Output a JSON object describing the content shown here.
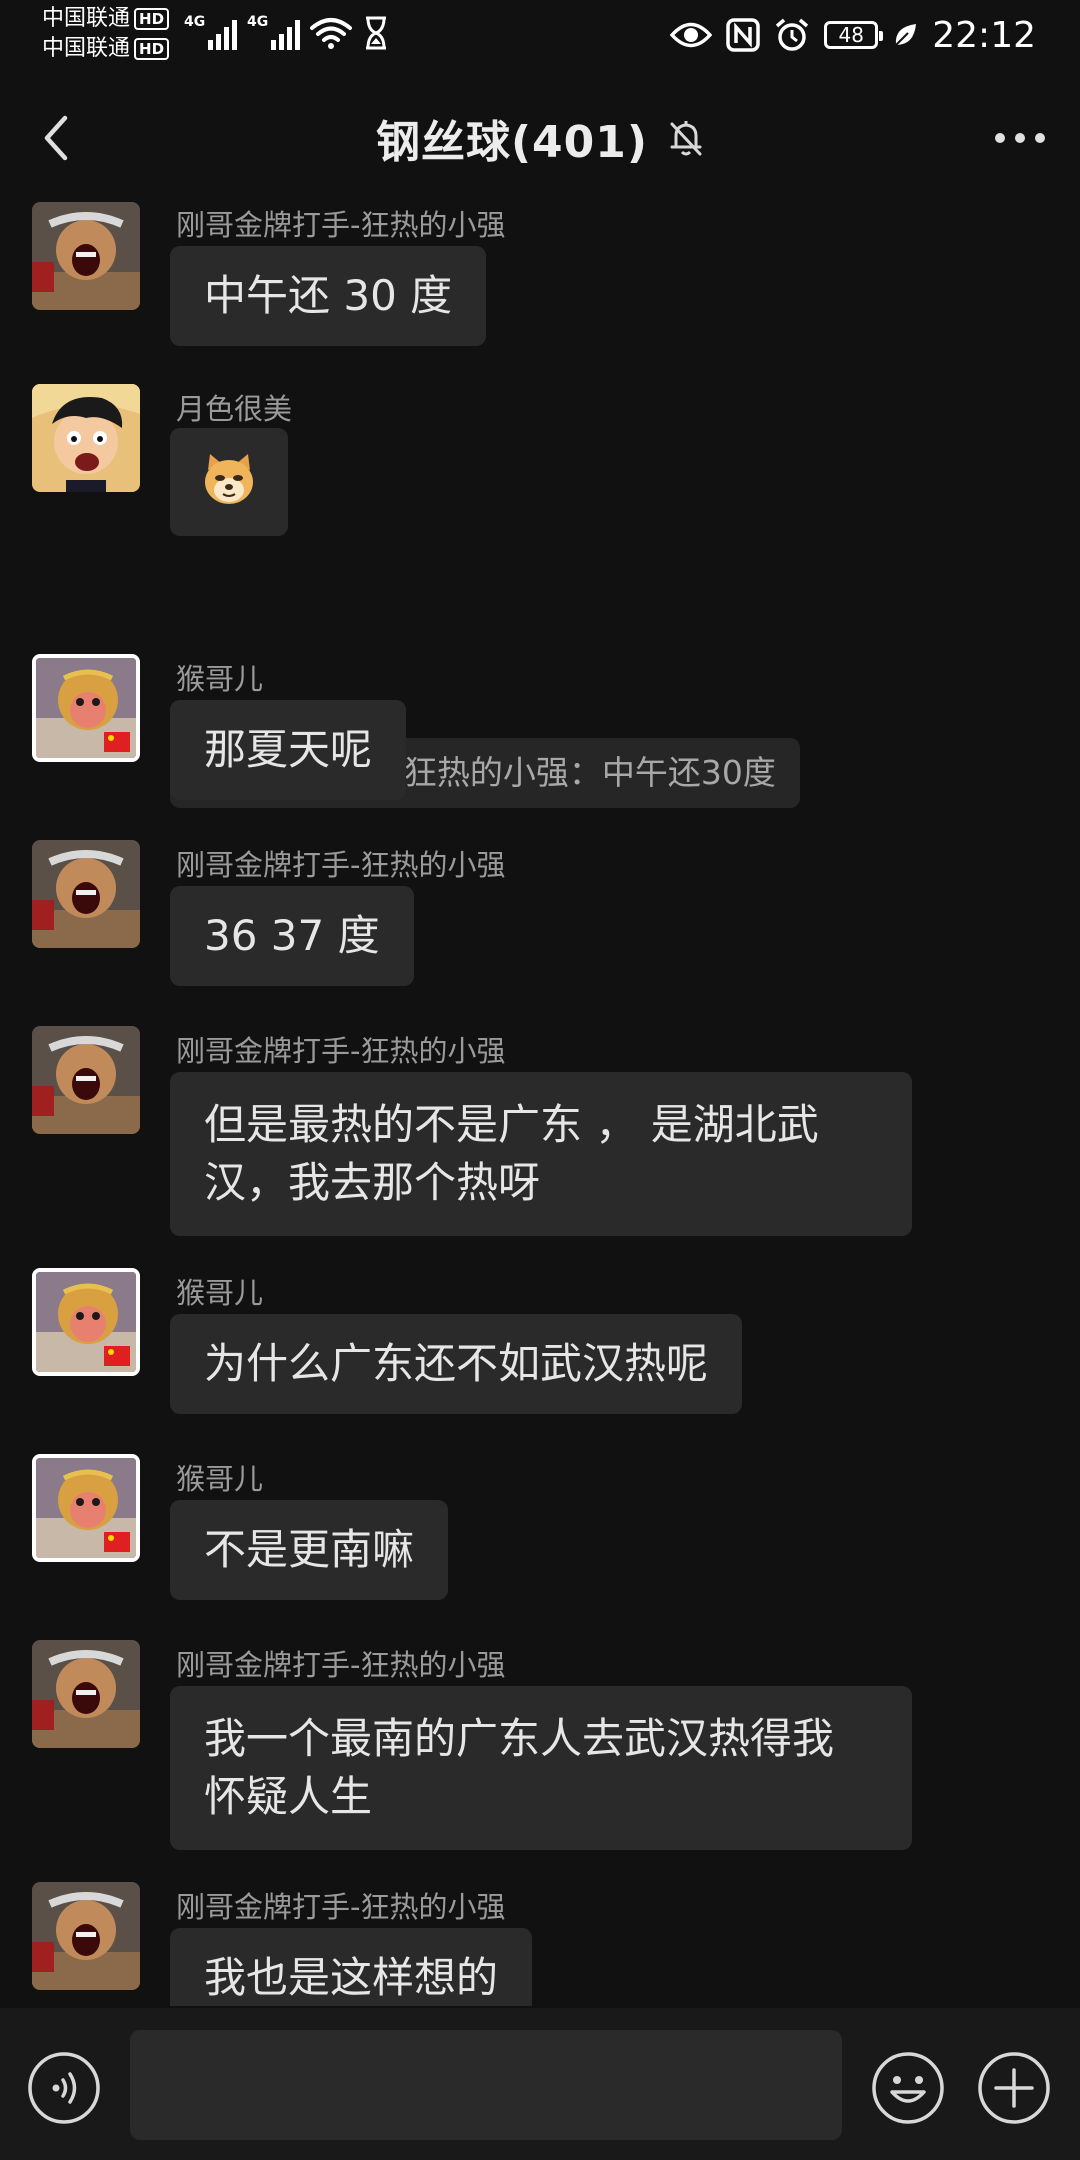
{
  "status_bar": {
    "carrier_1": "中国联通",
    "carrier_2": "中国联通",
    "hd_badge": "HD",
    "network_1": "4G",
    "network_2": "4G",
    "battery_level": "48",
    "time": "22:12",
    "icons": [
      "wifi-icon",
      "hourglass-icon",
      "eye-icon",
      "nfc-icon",
      "alarm-icon",
      "battery-icon",
      "leaf-icon"
    ]
  },
  "header": {
    "title": "钢丝球(401)",
    "icons": [
      "back-chevron-icon",
      "mute-bell-icon",
      "more-dots-icon"
    ]
  },
  "messages": [
    {
      "sender": "刚哥金牌打手-狂热的小强",
      "avatar": "muscle-man-avatar",
      "text": "中午还 30 度"
    },
    {
      "sender": "月色很美",
      "avatar": "luffy-avatar",
      "emoji": "doge-emoji",
      "quote": "刚哥金牌打手-狂热的小强：中午还30度"
    },
    {
      "sender": "猴哥儿",
      "avatar": "monkey-king-avatar",
      "text": "那夏天呢"
    },
    {
      "sender": "刚哥金牌打手-狂热的小强",
      "avatar": "muscle-man-avatar",
      "text": "36 37 度"
    },
    {
      "sender": "刚哥金牌打手-狂热的小强",
      "avatar": "muscle-man-avatar",
      "line1": "但是最热的不是广东 ， 是湖北武",
      "line2": "汉，我去那个热呀"
    },
    {
      "sender": "猴哥儿",
      "avatar": "monkey-king-avatar",
      "text": "为什么广东还不如武汉热呢"
    },
    {
      "sender": "猴哥儿",
      "avatar": "monkey-king-avatar",
      "text": "不是更南嘛"
    },
    {
      "sender": "刚哥金牌打手-狂热的小强",
      "avatar": "muscle-man-avatar",
      "line1": "我一个最南的广东人去武汉热得我",
      "line2": "怀疑人生"
    },
    {
      "sender": "刚哥金牌打手-狂热的小强",
      "avatar": "muscle-man-avatar",
      "text": "我也是这样想的"
    }
  ],
  "input_bar": {
    "placeholder": "",
    "icons": [
      "voice-icon",
      "emoji-face-icon",
      "plus-icon"
    ]
  },
  "colors": {
    "background": "#111111",
    "bubble": "#2a2a2a",
    "sender_text": "#9a9a9a",
    "message_text": "#e6e6e6",
    "input_bar": "#191919"
  }
}
